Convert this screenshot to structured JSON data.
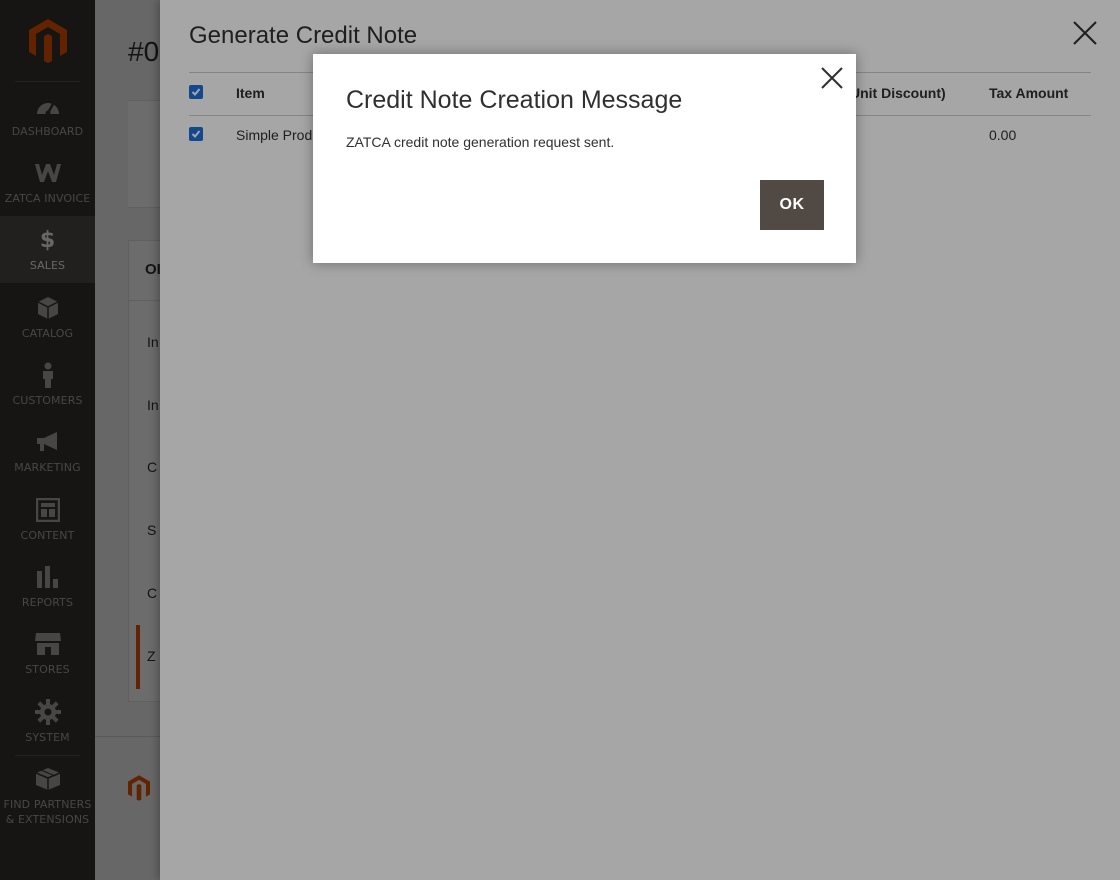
{
  "sidebar": {
    "items": [
      {
        "label": "DASHBOARD",
        "icon": "dashboard-icon"
      },
      {
        "label": "ZATCA INVOICE",
        "icon": "zatca-icon"
      },
      {
        "label": "SALES",
        "icon": "dollar-icon"
      },
      {
        "label": "CATALOG",
        "icon": "box-icon"
      },
      {
        "label": "CUSTOMERS",
        "icon": "person-icon"
      },
      {
        "label": "MARKETING",
        "icon": "megaphone-icon"
      },
      {
        "label": "CONTENT",
        "icon": "content-icon"
      },
      {
        "label": "REPORTS",
        "icon": "bar-chart-icon"
      },
      {
        "label": "STORES",
        "icon": "store-icon"
      },
      {
        "label": "SYSTEM",
        "icon": "gear-icon"
      }
    ],
    "partners_line1": "FIND PARTNERS",
    "partners_line2": "& EXTENSIONS",
    "active": "SALES"
  },
  "background_page": {
    "title_fragment": "#0",
    "section_fragment": "OI",
    "tab_fragments": [
      "In",
      "In",
      "C",
      "S",
      "C",
      "Z"
    ]
  },
  "slide_panel": {
    "title": "Generate Credit Note",
    "columns": {
      "item": "Item",
      "unit_discount": "Unit Discount)",
      "tax_amount": "Tax Amount"
    },
    "row": {
      "item": "Simple Prod",
      "tax_amount": "0.00",
      "checked": true
    },
    "header_checked": true
  },
  "modal": {
    "title": "Credit Note Creation Message",
    "message": "ZATCA credit note generation request sent.",
    "ok_label": "OK"
  },
  "colors": {
    "sidebar_bg": "#373330",
    "sidebar_active": "#524d49",
    "brand_orange": "#eb5202",
    "button_dark": "#514943",
    "checkbox_blue": "#1e6fd9"
  }
}
